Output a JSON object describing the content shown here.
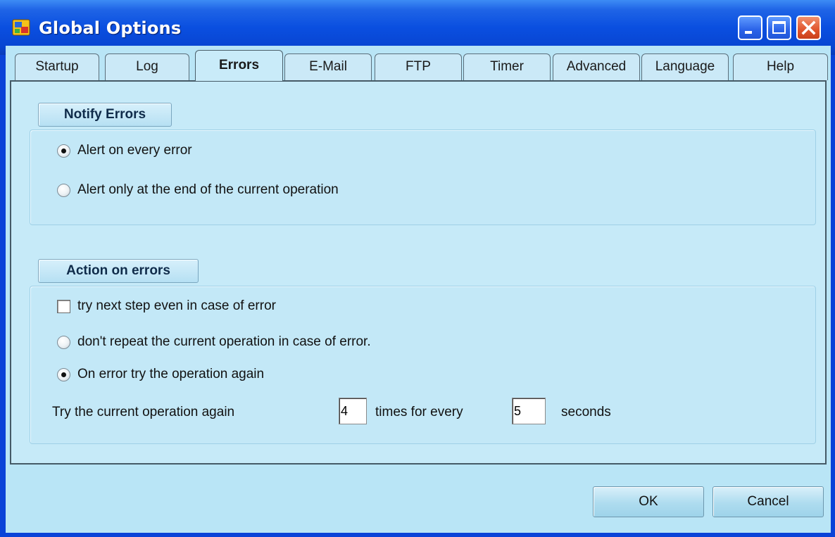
{
  "window": {
    "title": "Global Options"
  },
  "tabs": [
    {
      "label": "Startup"
    },
    {
      "label": "Log"
    },
    {
      "label": "Errors"
    },
    {
      "label": "E-Mail"
    },
    {
      "label": "FTP"
    },
    {
      "label": "Timer"
    },
    {
      "label": "Advanced"
    },
    {
      "label": "Language"
    },
    {
      "label": "Help"
    }
  ],
  "active_tab": "Errors",
  "notify": {
    "heading": "Notify Errors",
    "options": [
      {
        "label": "Alert on every error",
        "selected": true
      },
      {
        "label": "Alert only at the end of the current operation",
        "selected": false
      }
    ]
  },
  "action": {
    "heading": "Action on errors",
    "try_next_label": "try next step even in case of error",
    "try_next_checked": false,
    "options": [
      {
        "label": "don't repeat the current operation in case of error.",
        "selected": false
      },
      {
        "label": "On error try the operation again",
        "selected": true
      }
    ],
    "retry_prefix": "Try the current operation again",
    "retry_times": "4",
    "retry_mid": "times for every",
    "retry_seconds": "5",
    "retry_suffix": "seconds"
  },
  "buttons": {
    "ok": "OK",
    "cancel": "Cancel"
  },
  "colors": {
    "titlebar": "#0a4fe0",
    "client": "#b9e5f6",
    "close": "#e0542c"
  }
}
